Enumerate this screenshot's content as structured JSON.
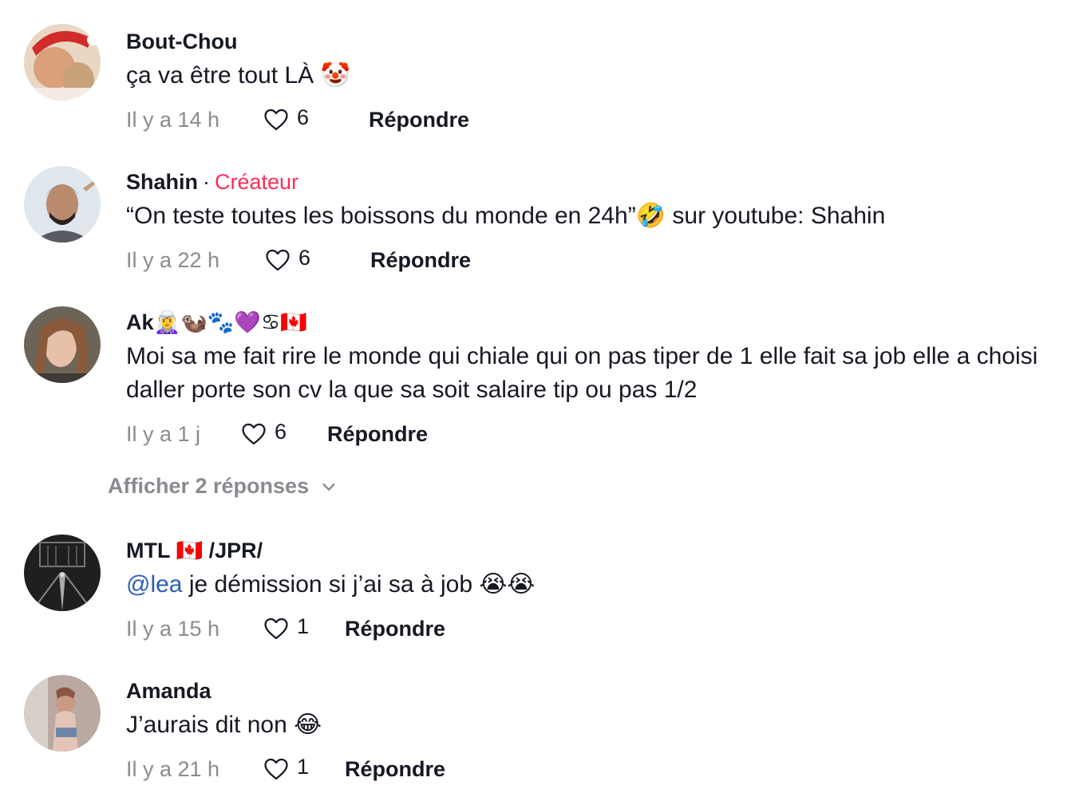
{
  "comments": [
    {
      "username": "Bout-Chou",
      "text": "ça va être tout LÀ 🤡",
      "time": "Il y a 14 h",
      "likes": "6",
      "reply_label": "Répondre"
    },
    {
      "username": "Shahin",
      "separator": "·",
      "badge": "Créateur",
      "text": "“On teste toutes les boissons du monde en 24h”🤣 sur youtube: Shahin",
      "time": "Il y a 22 h",
      "likes": "6",
      "reply_label": "Répondre"
    },
    {
      "username": "Ak",
      "username_emojis": "🧝‍♀️🦦🐾💜♋🇨🇦",
      "text": "Moi sa me fait rire le monde qui chiale qui on pas tiper de 1 elle fait sa job elle a choisi daller porte son cv la que sa soit salaire tip ou pas 1/2",
      "time": "Il y a 1 j",
      "likes": "6",
      "reply_label": "Répondre",
      "view_replies": "Afficher 2 réponses"
    },
    {
      "username": "MTL 🇨🇦 /JPR/",
      "mention": "@lea",
      "text": " je démission si j’ai sa à job 😭😭",
      "time": "Il y a 15 h",
      "likes": "1",
      "reply_label": "Répondre"
    },
    {
      "username": "Amanda",
      "text": "J’aurais dit non 😂",
      "time": "Il y a 21 h",
      "likes": "1",
      "reply_label": "Répondre"
    }
  ],
  "colors": {
    "creator_badge": "#fe2c55",
    "mention": "#2b5db9",
    "muted": "#8a8b91",
    "text": "#161823"
  },
  "icons": {
    "like": "heart-outline-icon",
    "expand": "chevron-down-icon"
  }
}
